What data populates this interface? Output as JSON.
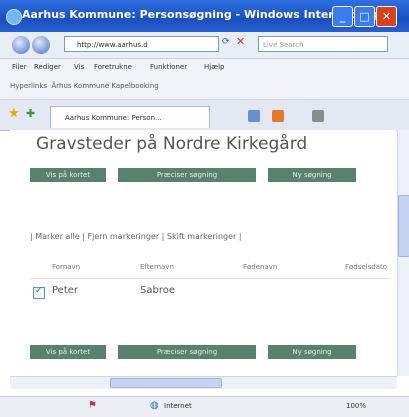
{
  "window": {
    "title": "Aarhus Kommune: Personsøgning - Windows Internet Expl..."
  },
  "toolbar": {
    "address": "http://www.aarhus.d",
    "search_placeholder": "Live Search"
  },
  "menu": {
    "items": [
      "Filer",
      "Rediger",
      "Vis",
      "Foretrukne",
      "Funktioner",
      "Hjælp"
    ]
  },
  "links_bar": {
    "label": "Hyperlinks",
    "item": "Århus Kommune Kapelbooking"
  },
  "tab": {
    "title": "Aarhus Kommune: Person..."
  },
  "page": {
    "heading": "Gravsteder på Nordre Kirkegård",
    "buttons": {
      "map": "Vis på kortet",
      "refine": "Præciser søgning",
      "new": "Ny søgning"
    },
    "actions_text": "| Marker alle | Fjern markeringer | Skift markeringer |",
    "columns": [
      "Fornavn",
      "Efternavn",
      "Fødenavn",
      "Fødselsdato"
    ],
    "rows": [
      {
        "first": "Peter",
        "last": "Sabroe",
        "checked": true
      }
    ]
  },
  "status": {
    "zone": "Internet",
    "zoom": "100%"
  }
}
